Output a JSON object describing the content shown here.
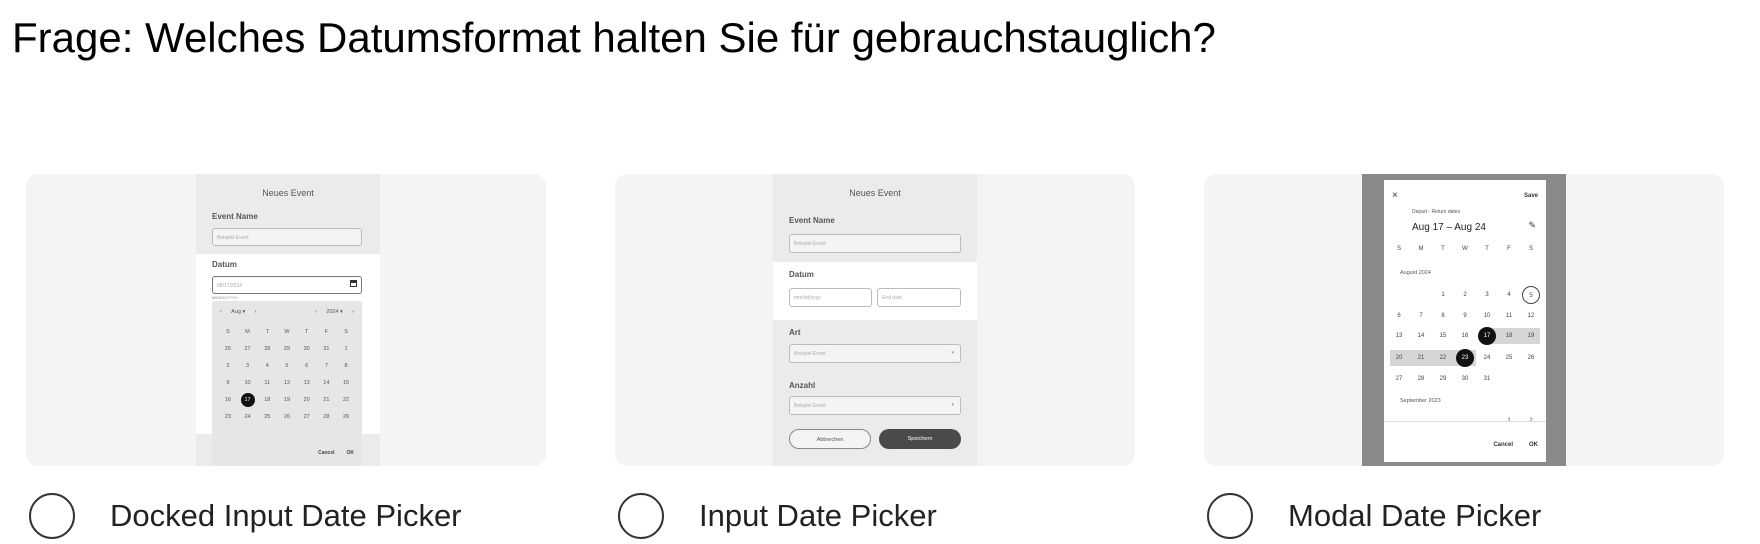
{
  "question": "Frage: Welches Datumsformat halten Sie für gebrauchstauglich?",
  "options": [
    {
      "label": "Docked Input Date Picker"
    },
    {
      "label": "Input Date Picker"
    },
    {
      "label": "Modal Date Picker"
    }
  ],
  "docked": {
    "title": "Neues Event",
    "event_label": "Event Name",
    "event_placeholder": "Beispiel Event",
    "date_label": "Datum",
    "date_value": "08/17/2024",
    "date_hint": "MM/DD/YYYY",
    "month": "Aug",
    "year": "2024",
    "weekdays": [
      "S",
      "M",
      "T",
      "W",
      "T",
      "F",
      "S"
    ],
    "weeks": [
      [
        "26",
        "27",
        "28",
        "29",
        "30",
        "31",
        "1"
      ],
      [
        "2",
        "3",
        "4",
        "5",
        "6",
        "7",
        "8"
      ],
      [
        "9",
        "10",
        "11",
        "12",
        "13",
        "14",
        "15"
      ],
      [
        "16",
        "17",
        "18",
        "19",
        "20",
        "21",
        "22"
      ],
      [
        "23",
        "24",
        "25",
        "26",
        "27",
        "28",
        "29"
      ]
    ],
    "cancel": "Cancel",
    "ok": "OK"
  },
  "input": {
    "title": "Neues Event",
    "event_label": "Event Name",
    "event_placeholder": "Beispiel Event",
    "date_label": "Datum",
    "start_placeholder": "mm/dd/yyyy",
    "end_placeholder": "End date",
    "art_label": "Art",
    "art_placeholder": "Beispiel Event",
    "anzahl_label": "Anzahl",
    "anzahl_placeholder": "Beispiel Event",
    "cancel": "Abbrechen",
    "save": "Speichern"
  },
  "modal": {
    "close": "×",
    "save": "Save",
    "subtitle": "Depart - Return dates",
    "range": "Aug 17 – Aug 24",
    "edit": "✎",
    "weekdays": [
      "S",
      "M",
      "T",
      "W",
      "T",
      "F",
      "S"
    ],
    "month1": "August 2024",
    "weeks": [
      [
        "",
        "",
        "1",
        "2",
        "3",
        "4",
        "5"
      ],
      [
        "6",
        "7",
        "8",
        "9",
        "10",
        "11",
        "12"
      ],
      [
        "13",
        "14",
        "15",
        "16",
        "17",
        "18",
        "19"
      ],
      [
        "20",
        "21",
        "22",
        "23",
        "24",
        "25",
        "26"
      ],
      [
        "27",
        "28",
        "29",
        "30",
        "31",
        "",
        ""
      ]
    ],
    "month2": "September 2023",
    "sept_row": [
      "",
      "",
      "",
      "",
      "",
      "1",
      "2"
    ],
    "cancel": "Cancel",
    "ok": "OK"
  }
}
